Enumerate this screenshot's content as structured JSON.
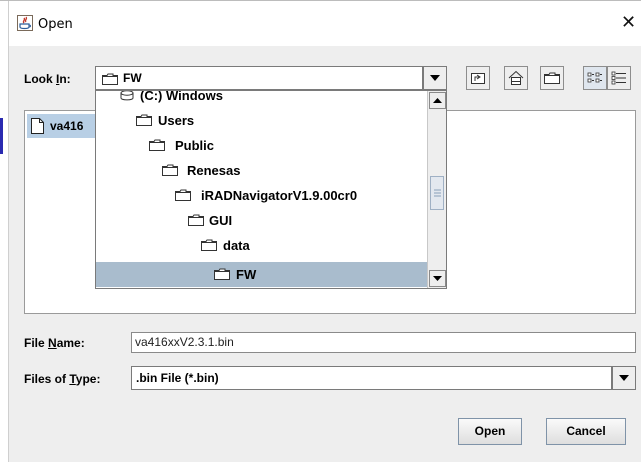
{
  "window": {
    "title": "Open",
    "close_glyph": "✕"
  },
  "look_in": {
    "label": "Look In:",
    "value": "FW"
  },
  "dropdown_items": [
    {
      "label": "(C:) Windows",
      "icon": "drive-icon"
    },
    {
      "label": "Users",
      "icon": "folder-icon"
    },
    {
      "label": "Public",
      "icon": "folder-icon"
    },
    {
      "label": "Renesas",
      "icon": "folder-icon"
    },
    {
      "label": "iRADNavigatorV1.9.00cr0",
      "icon": "folder-icon"
    },
    {
      "label": "GUI",
      "icon": "folder-icon"
    },
    {
      "label": "data",
      "icon": "folder-icon"
    },
    {
      "label": "FW",
      "icon": "folder-icon",
      "selected": true
    }
  ],
  "file_list": [
    {
      "name": "va416"
    }
  ],
  "file_name": {
    "label": "File Name:",
    "value": "va416xxV2.3.1.bin"
  },
  "file_type": {
    "label": "Files of Type:",
    "value": ".bin File (*.bin)"
  },
  "buttons": {
    "open": "Open",
    "cancel": "Cancel"
  },
  "toolbar_icons": [
    "up-folder-icon",
    "home-icon",
    "new-folder-icon",
    "list-view-icon",
    "details-view-icon"
  ],
  "colors": {
    "selection": "#a9bccd",
    "file_selection": "#b8cfe5",
    "panel": "#eeeeee"
  }
}
